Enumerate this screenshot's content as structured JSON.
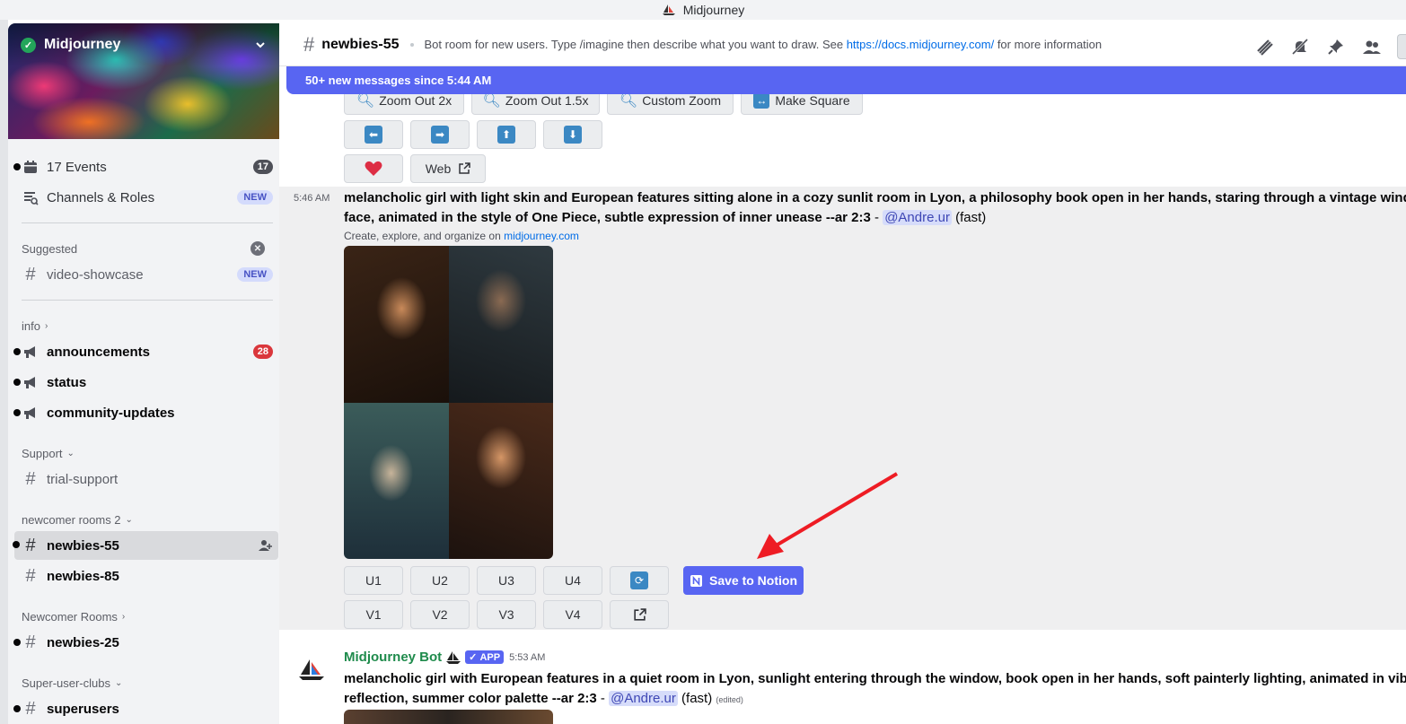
{
  "window": {
    "title": "Midjourney"
  },
  "sidebar": {
    "server_name": "Midjourney",
    "events": {
      "label": "17 Events",
      "count": "17"
    },
    "channels_roles": {
      "label": "Channels & Roles",
      "badge": "NEW"
    },
    "suggested": {
      "label": "Suggested",
      "channel": "video-showcase",
      "badge": "NEW"
    },
    "categories": {
      "info": "info",
      "support": "Support",
      "newcomer_rooms_2": "newcomer rooms 2",
      "newcomer_rooms": "Newcomer Rooms",
      "super_user_clubs": "Super-user-clubs"
    },
    "channels": {
      "announcements": {
        "label": "announcements",
        "count": "28"
      },
      "status": "status",
      "community_updates": "community-updates",
      "trial_support": "trial-support",
      "newbies_55": "newbies-55",
      "newbies_85": "newbies-85",
      "newbies_25": "newbies-25",
      "superusers": "superusers"
    }
  },
  "header": {
    "channel_name": "newbies-55",
    "topic_prefix": "Bot room for new users. Type /imagine then describe what you want to draw. See ",
    "topic_link": "https://docs.midjourney.com/",
    "topic_suffix": " for more information"
  },
  "new_messages_bar": "50+ new messages since 5:44 AM",
  "prev_buttons": {
    "zoom_out_2x": "Zoom Out 2x",
    "zoom_out_1_5x": "Zoom Out 1.5x",
    "custom_zoom": "Custom Zoom",
    "make_square": "Make Square",
    "web": "Web"
  },
  "message1": {
    "time": "5:46 AM",
    "prompt_line1": "melancholic girl with light skin and European features sitting alone in a cozy sunlit room in Lyon, a philosophy book open in her hands, staring through a vintage window,",
    "prompt_line2": "face, animated in the style of One Piece, subtle expression of inner unease --ar 2:3",
    "dash": " - ",
    "mention": "@Andre.ur",
    "speed": " (fast)",
    "sub_prefix": "Create, explore, and organize on ",
    "sub_link": "midjourney.com",
    "buttons": {
      "u1": "U1",
      "u2": "U2",
      "u3": "U3",
      "u4": "U4",
      "v1": "V1",
      "v2": "V2",
      "v3": "V3",
      "v4": "V4",
      "save_to_notion": "Save to Notion"
    }
  },
  "message2": {
    "author": "Midjourney Bot",
    "app_tag": "APP",
    "time": "5:53 AM",
    "prompt_line1": "melancholic girl with European features in a quiet room in Lyon, sunlight entering through the window, book open in her hands, soft painterly lighting, animated in vibrant",
    "prompt_line2": "reflection, summer color palette --ar 2:3",
    "dash": " - ",
    "mention": "@Andre.ur",
    "speed": " (fast) ",
    "edited": "(edited)"
  }
}
